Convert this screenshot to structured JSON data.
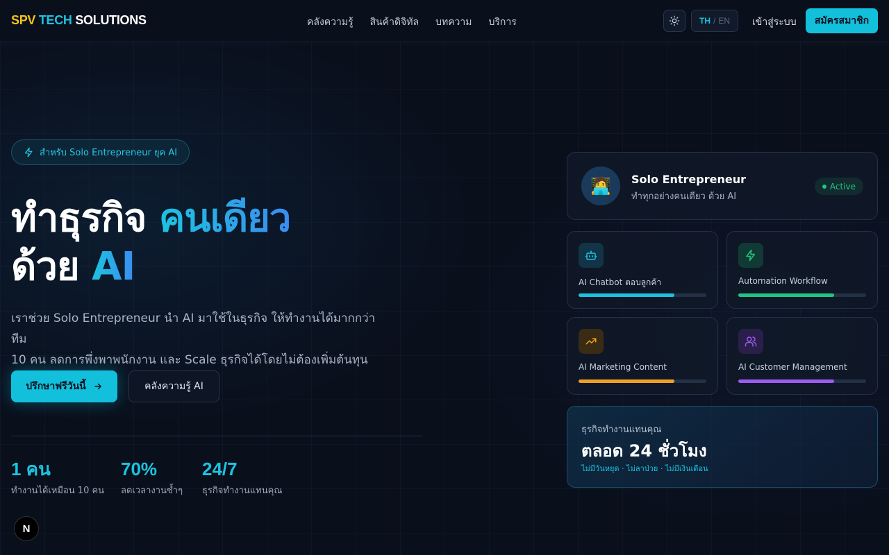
{
  "brand": {
    "part1": "SPV",
    "part2": "TECH",
    "part3": "SOLUTIONS"
  },
  "nav": {
    "links": [
      "คลังความรู้",
      "สินค้าดิจิทัล",
      "บทความ",
      "บริการ"
    ],
    "theme_icon": "sun-icon",
    "lang_active": "TH",
    "lang_sep": "/",
    "lang_inactive": "EN",
    "login": "เข้าสู่ระบบ",
    "signup": "สมัครสมาชิก"
  },
  "hero": {
    "badge_icon": "lightning-icon",
    "badge": "สำหรับ Solo Entrepreneur ยุค AI",
    "title_line1": "ทำธุรกิจ",
    "title_accent1": "คนเดียว",
    "title_line2": "ด้วย",
    "title_accent2": "AI",
    "desc_line1": "เราช่วย Solo Entrepreneur นำ AI มาใช้ในธุรกิจ ให้ทำงานได้มากกว่าทีม",
    "desc_line2": "10 คน ลดการพึ่งพาพนักงาน และ Scale ธุรกิจได้โดยไม่ต้องเพิ่มต้นทุน",
    "cta_primary": "ปรึกษาฟรีวันนี้",
    "cta_primary_icon": "arrow-right-icon",
    "cta_secondary": "คลังความรู้ AI"
  },
  "stats": [
    {
      "num": "1 คน",
      "label": "ทำงานได้เหมือน 10 คน"
    },
    {
      "num": "70%",
      "label": "ลดเวลางานซ้ำๆ"
    },
    {
      "num": "24/7",
      "label": "ธุรกิจทำงานแทนคุณ"
    }
  ],
  "fab_label": "N",
  "profile": {
    "avatar_icon": "person-laptop-icon",
    "name": "Solo Entrepreneur",
    "subtitle": "ทำทุกอย่างคนเดียว ด้วย AI",
    "status": "Active"
  },
  "features": [
    {
      "label": "AI Chatbot ตอบลูกค้า",
      "icon": "bot-icon",
      "color": "#1cc3e0",
      "icon_bg": "#113447",
      "progress": 0.75
    },
    {
      "label": "Automation Workflow",
      "icon": "lightning-icon",
      "color": "#22c483",
      "icon_bg": "#113a35",
      "progress": 0.75
    },
    {
      "label": "AI Marketing Content",
      "icon": "trending-up-icon",
      "color": "#f0a020",
      "icon_bg": "#3a2c14",
      "progress": 0.75
    },
    {
      "label": "AI Customer Management",
      "icon": "users-icon",
      "color": "#9b5cf0",
      "icon_bg": "#2a1f4a",
      "progress": 0.75
    }
  ],
  "hours": {
    "label": "ธุรกิจทำงานแทนคุณ",
    "value": "ตลอด 24 ชั่วโมง",
    "note": "ไม่มีวันหยุด · ไม่ลาป่วย · ไม่มีเงินเดือน"
  }
}
